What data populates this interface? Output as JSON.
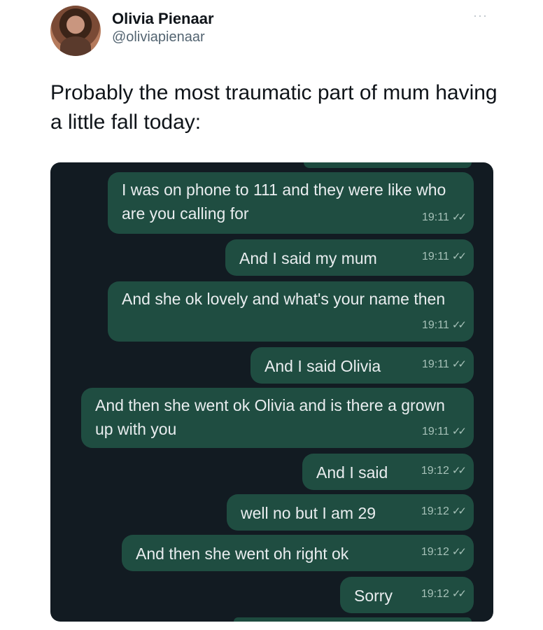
{
  "tweet": {
    "author_name": "Olivia Pienaar",
    "author_handle": "@oliviapienaar",
    "more_icon": "···",
    "text": "Probably the most traumatic part of mum having a little fall today:"
  },
  "chat": {
    "messages": [
      {
        "text": "I was on phone to 111 and they were like who are you calling for",
        "time": "19:11"
      },
      {
        "text": "And I said my mum",
        "time": "19:11"
      },
      {
        "text": "And she ok lovely and what's your name then",
        "time": "19:11"
      },
      {
        "text": "And I said Olivia",
        "time": "19:11"
      },
      {
        "text": "And then she went ok Olivia and is there a grown up with you",
        "time": "19:11"
      },
      {
        "text": "And I said",
        "time": "19:12"
      },
      {
        "text": "well no but I am 29",
        "time": "19:12"
      },
      {
        "text": "And then she went oh right ok",
        "time": "19:12"
      },
      {
        "text": "Sorry",
        "time": "19:12"
      }
    ],
    "read_tick": "✓✓"
  },
  "colors": {
    "chat_background": "#121b22",
    "bubble": "#1f4d41",
    "handle": "#536471"
  }
}
